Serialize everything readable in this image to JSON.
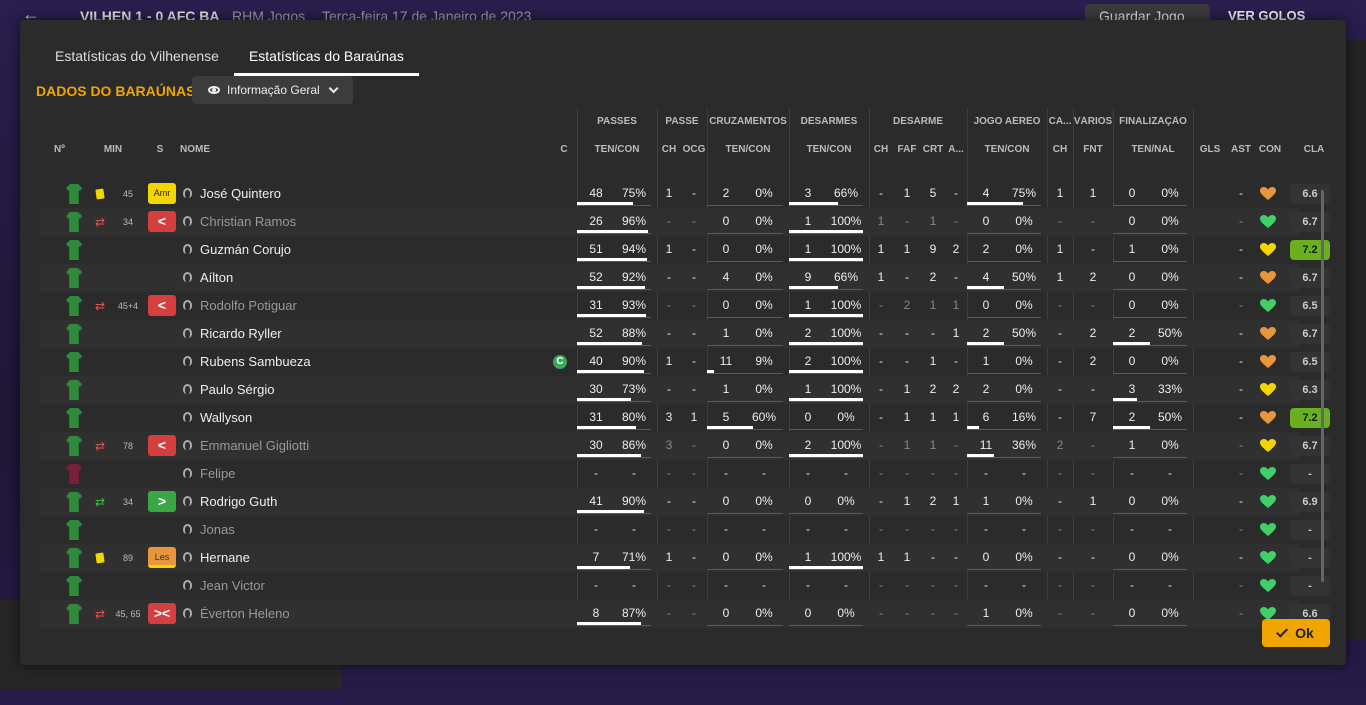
{
  "background": {
    "score": "VILHEN  1 - 0  AFC BA",
    "competition": "RHM Jogos",
    "date": "Terça-feira 17 de Janeiro de 2023",
    "save_label": "Guardar Jogo",
    "goals_label": "VER GOLOS"
  },
  "tabs": [
    "Estatísticas do Vilhenense",
    "Estatísticas do Baraúnas"
  ],
  "section_title": "DADOS DO BARAÚNAS",
  "view_dropdown": "Informação Geral",
  "ok_label": "Ok",
  "group_headers": [
    "PASSES",
    "PASSE",
    "CRUZAMENTOS",
    "DESARMES",
    "DESARME",
    "JOGO AÉREO",
    "CA...",
    "VÁRIOS",
    "FINALIZAÇÃO"
  ],
  "columns": [
    "Nº",
    "MIN",
    "S",
    "NOME",
    "C",
    "TEN/CON",
    "CH",
    "OCG",
    "TEN/CON",
    "TEN/CON",
    "CH",
    "FAF",
    "CRT",
    "A...",
    "TEN/CON",
    "CH",
    "FNT",
    "TEN/NAL",
    "GLS",
    "AST",
    "CON",
    "CLA"
  ],
  "players": [
    {
      "name": "José Quintero",
      "min": "45",
      "pos": "Amr",
      "pos_style": "amr",
      "card": "yellow",
      "sub": "",
      "cap": "",
      "dim": false,
      "passes": [
        "48",
        "75%"
      ],
      "pch": "1",
      "ocg": "-",
      "cruz": [
        "2",
        "0%"
      ],
      "des": [
        "3",
        "66%"
      ],
      "dch": "-",
      "faf": "1",
      "crt": "5",
      "a": "-",
      "aer": [
        "4",
        "75%"
      ],
      "cach": "1",
      "fnt": "1",
      "fin": [
        "0",
        "0%"
      ],
      "gls": "",
      "ast": "-",
      "con": "orange",
      "cla": "6.6",
      "cla_high": false
    },
    {
      "name": "Christian Ramos",
      "min": "34",
      "pos": "<",
      "pos_style": "red",
      "card": "",
      "sub": "out",
      "cap": "",
      "dim": true,
      "passes": [
        "26",
        "96%"
      ],
      "pch": "-",
      "ocg": "-",
      "cruz": [
        "0",
        "0%"
      ],
      "des": [
        "1",
        "100%"
      ],
      "dch": "1",
      "faf": "-",
      "crt": "1",
      "a": "-",
      "aer": [
        "0",
        "0%"
      ],
      "cach": "-",
      "fnt": "-",
      "fin": [
        "0",
        "0%"
      ],
      "gls": "",
      "ast": "-",
      "con": "green",
      "cla": "6.7",
      "cla_high": false
    },
    {
      "name": "Guzmán Corujo",
      "min": "",
      "pos": "",
      "pos_style": "",
      "card": "",
      "sub": "",
      "cap": "",
      "dim": false,
      "passes": [
        "51",
        "94%"
      ],
      "pch": "1",
      "ocg": "-",
      "cruz": [
        "0",
        "0%"
      ],
      "des": [
        "1",
        "100%"
      ],
      "dch": "1",
      "faf": "1",
      "crt": "9",
      "a": "2",
      "aer": [
        "2",
        "0%"
      ],
      "cach": "1",
      "fnt": "-",
      "fin": [
        "1",
        "0%"
      ],
      "gls": "",
      "ast": "-",
      "con": "yellow",
      "cla": "7.2",
      "cla_high": true
    },
    {
      "name": "Aílton",
      "min": "",
      "pos": "",
      "pos_style": "",
      "card": "",
      "sub": "",
      "cap": "",
      "dim": false,
      "passes": [
        "52",
        "92%"
      ],
      "pch": "-",
      "ocg": "-",
      "cruz": [
        "4",
        "0%"
      ],
      "des": [
        "9",
        "66%"
      ],
      "dch": "1",
      "faf": "-",
      "crt": "2",
      "a": "-",
      "aer": [
        "4",
        "50%"
      ],
      "cach": "1",
      "fnt": "2",
      "fin": [
        "0",
        "0%"
      ],
      "gls": "",
      "ast": "-",
      "con": "orange",
      "cla": "6.7",
      "cla_high": false
    },
    {
      "name": "Rodolfo Potiguar",
      "min": "45+4",
      "pos": "<",
      "pos_style": "red",
      "card": "",
      "sub": "out",
      "cap": "",
      "dim": true,
      "passes": [
        "31",
        "93%"
      ],
      "pch": "-",
      "ocg": "-",
      "cruz": [
        "0",
        "0%"
      ],
      "des": [
        "1",
        "100%"
      ],
      "dch": "-",
      "faf": "2",
      "crt": "1",
      "a": "1",
      "aer": [
        "0",
        "0%"
      ],
      "cach": "-",
      "fnt": "-",
      "fin": [
        "0",
        "0%"
      ],
      "gls": "",
      "ast": "-",
      "con": "green",
      "cla": "6.5",
      "cla_high": false
    },
    {
      "name": "Ricardo Ryller",
      "min": "",
      "pos": "",
      "pos_style": "",
      "card": "",
      "sub": "",
      "cap": "",
      "dim": false,
      "passes": [
        "52",
        "88%"
      ],
      "pch": "-",
      "ocg": "-",
      "cruz": [
        "1",
        "0%"
      ],
      "des": [
        "2",
        "100%"
      ],
      "dch": "-",
      "faf": "-",
      "crt": "-",
      "a": "1",
      "aer": [
        "2",
        "50%"
      ],
      "cach": "-",
      "fnt": "2",
      "fin": [
        "2",
        "50%"
      ],
      "gls": "",
      "ast": "-",
      "con": "orange",
      "cla": "6.7",
      "cla_high": false
    },
    {
      "name": "Rubens Sambueza",
      "min": "",
      "pos": "",
      "pos_style": "",
      "card": "",
      "sub": "",
      "cap": "C",
      "dim": false,
      "passes": [
        "40",
        "90%"
      ],
      "pch": "1",
      "ocg": "-",
      "cruz": [
        "11",
        "9%"
      ],
      "des": [
        "2",
        "100%"
      ],
      "dch": "-",
      "faf": "-",
      "crt": "1",
      "a": "-",
      "aer": [
        "1",
        "0%"
      ],
      "cach": "-",
      "fnt": "2",
      "fin": [
        "0",
        "0%"
      ],
      "gls": "",
      "ast": "-",
      "con": "orange",
      "cla": "6.5",
      "cla_high": false
    },
    {
      "name": "Paulo Sérgio",
      "min": "",
      "pos": "",
      "pos_style": "",
      "card": "",
      "sub": "",
      "cap": "",
      "dim": false,
      "passes": [
        "30",
        "73%"
      ],
      "pch": "-",
      "ocg": "-",
      "cruz": [
        "1",
        "0%"
      ],
      "des": [
        "1",
        "100%"
      ],
      "dch": "-",
      "faf": "1",
      "crt": "2",
      "a": "2",
      "aer": [
        "2",
        "0%"
      ],
      "cach": "-",
      "fnt": "-",
      "fin": [
        "3",
        "33%"
      ],
      "gls": "",
      "ast": "-",
      "con": "yellow",
      "cla": "6.3",
      "cla_high": false
    },
    {
      "name": "Wallyson",
      "min": "",
      "pos": "",
      "pos_style": "",
      "card": "",
      "sub": "",
      "cap": "",
      "dim": false,
      "passes": [
        "31",
        "80%"
      ],
      "pch": "3",
      "ocg": "1",
      "cruz": [
        "5",
        "60%"
      ],
      "des": [
        "0",
        "0%"
      ],
      "dch": "-",
      "faf": "1",
      "crt": "1",
      "a": "1",
      "aer": [
        "6",
        "16%"
      ],
      "cach": "-",
      "fnt": "7",
      "fin": [
        "2",
        "50%"
      ],
      "gls": "",
      "ast": "-",
      "con": "orange",
      "cla": "7.2",
      "cla_high": true
    },
    {
      "name": "Emmanuel Gigliotti",
      "min": "78",
      "pos": "<",
      "pos_style": "red",
      "card": "",
      "sub": "out",
      "cap": "",
      "dim": true,
      "passes": [
        "30",
        "86%"
      ],
      "pch": "3",
      "ocg": "-",
      "cruz": [
        "0",
        "0%"
      ],
      "des": [
        "2",
        "100%"
      ],
      "dch": "-",
      "faf": "1",
      "crt": "1",
      "a": "-",
      "aer": [
        "11",
        "36%"
      ],
      "cach": "2",
      "fnt": "-",
      "fin": [
        "1",
        "0%"
      ],
      "gls": "",
      "ast": "-",
      "con": "yellow",
      "cla": "6.7",
      "cla_high": false
    },
    {
      "name": "Felipe",
      "min": "",
      "pos": "",
      "pos_style": "",
      "card": "",
      "sub": "",
      "cap": "",
      "dim": true,
      "gk": true,
      "passes": [
        "-",
        "-"
      ],
      "pch": "-",
      "ocg": "-",
      "cruz": [
        "-",
        "-"
      ],
      "des": [
        "-",
        "-"
      ],
      "dch": "-",
      "faf": "-",
      "crt": "-",
      "a": "-",
      "aer": [
        "-",
        "-"
      ],
      "cach": "-",
      "fnt": "-",
      "fin": [
        "-",
        "-"
      ],
      "gls": "",
      "ast": "-",
      "con": "green",
      "cla": "-",
      "cla_high": false
    },
    {
      "name": "Rodrigo Guth",
      "min": "34",
      "pos": ">",
      "pos_style": "green",
      "card": "",
      "sub": "in",
      "cap": "",
      "dim": false,
      "passes": [
        "41",
        "90%"
      ],
      "pch": "-",
      "ocg": "-",
      "cruz": [
        "0",
        "0%"
      ],
      "des": [
        "0",
        "0%"
      ],
      "dch": "-",
      "faf": "1",
      "crt": "2",
      "a": "1",
      "aer": [
        "1",
        "0%"
      ],
      "cach": "-",
      "fnt": "1",
      "fin": [
        "0",
        "0%"
      ],
      "gls": "",
      "ast": "-",
      "con": "green",
      "cla": "6.9",
      "cla_high": false
    },
    {
      "name": "Jonas",
      "min": "",
      "pos": "",
      "pos_style": "",
      "card": "",
      "sub": "",
      "cap": "",
      "dim": true,
      "passes": [
        "-",
        "-"
      ],
      "pch": "-",
      "ocg": "-",
      "cruz": [
        "-",
        "-"
      ],
      "des": [
        "-",
        "-"
      ],
      "dch": "-",
      "faf": "-",
      "crt": "-",
      "a": "-",
      "aer": [
        "-",
        "-"
      ],
      "cach": "-",
      "fnt": "-",
      "fin": [
        "-",
        "-"
      ],
      "gls": "",
      "ast": "-",
      "con": "green",
      "cla": "-",
      "cla_high": false
    },
    {
      "name": "Hernane",
      "min": "89",
      "pos": "Les",
      "pos_style": "les",
      "card": "yellow",
      "sub": "",
      "cap": "",
      "dim": false,
      "passes": [
        "7",
        "71%"
      ],
      "pch": "1",
      "ocg": "-",
      "cruz": [
        "0",
        "0%"
      ],
      "des": [
        "1",
        "100%"
      ],
      "dch": "1",
      "faf": "1",
      "crt": "-",
      "a": "-",
      "aer": [
        "0",
        "0%"
      ],
      "cach": "-",
      "fnt": "-",
      "fin": [
        "0",
        "0%"
      ],
      "gls": "",
      "ast": "-",
      "con": "green",
      "cla": "-",
      "cla_high": false
    },
    {
      "name": "Jean Victor",
      "min": "",
      "pos": "",
      "pos_style": "",
      "card": "",
      "sub": "",
      "cap": "",
      "dim": true,
      "passes": [
        "-",
        "-"
      ],
      "pch": "-",
      "ocg": "-",
      "cruz": [
        "-",
        "-"
      ],
      "des": [
        "-",
        "-"
      ],
      "dch": "-",
      "faf": "-",
      "crt": "-",
      "a": "-",
      "aer": [
        "-",
        "-"
      ],
      "cach": "-",
      "fnt": "-",
      "fin": [
        "-",
        "-"
      ],
      "gls": "",
      "ast": "-",
      "con": "green",
      "cla": "-",
      "cla_high": false
    },
    {
      "name": "Éverton Heleno",
      "min": "45, 65",
      "pos": "><",
      "pos_style": "red",
      "card": "",
      "sub": "both",
      "cap": "",
      "dim": true,
      "passes": [
        "8",
        "87%"
      ],
      "pch": "-",
      "ocg": "-",
      "cruz": [
        "0",
        "0%"
      ],
      "des": [
        "0",
        "0%"
      ],
      "dch": "-",
      "faf": "-",
      "crt": "-",
      "a": "-",
      "aer": [
        "1",
        "0%"
      ],
      "cach": "-",
      "fnt": "-",
      "fin": [
        "0",
        "0%"
      ],
      "gls": "",
      "ast": "-",
      "con": "green",
      "cla": "6.6",
      "cla_high": false
    }
  ],
  "colors": {
    "accent": "#f0a500",
    "high_rating": "#6ab01e",
    "con_green": "#3fd06a",
    "con_yellow": "#f3d600",
    "con_orange": "#e8963d"
  }
}
